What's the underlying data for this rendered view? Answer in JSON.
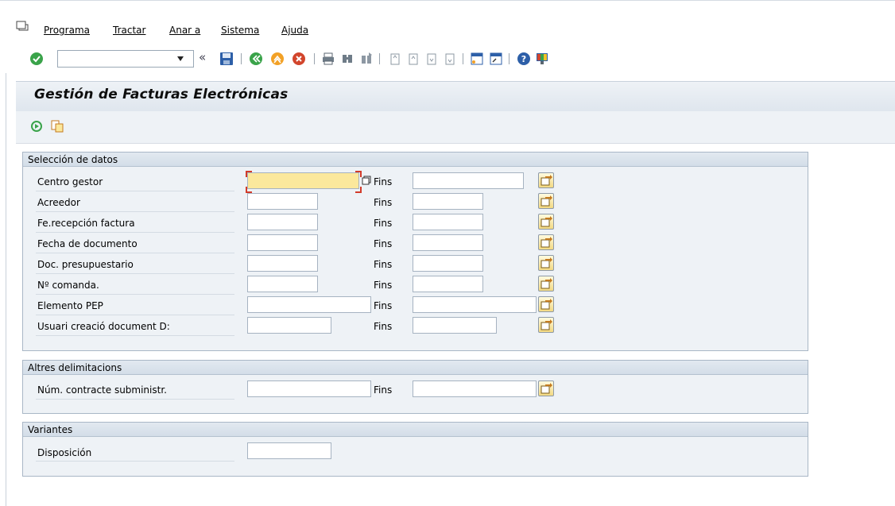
{
  "menu": {
    "items": [
      "Programa",
      "Tractar",
      "Anar a",
      "Sistema",
      "Ajuda"
    ]
  },
  "toolbar": {
    "command_value": "",
    "icons": [
      "check-icon",
      "dropdown-icon",
      "back-chevrons-icon",
      "save-icon",
      "back-icon",
      "exit-icon",
      "cancel-icon",
      "print-icon",
      "find-icon",
      "find-next-icon",
      "first-page-icon",
      "previous-page-icon",
      "next-page-icon",
      "last-page-icon",
      "new-session-icon",
      "shortcut-icon",
      "help-icon",
      "customize-layout-icon"
    ]
  },
  "title": "Gestión de Facturas Electrónicas",
  "app_toolbar": {
    "icons": [
      "execute-icon",
      "get-variant-icon"
    ]
  },
  "groups": {
    "seleccion": {
      "title": "Selección de datos",
      "to_label": "Fins",
      "rows": [
        {
          "label": "Centro gestor",
          "from": "",
          "to": ""
        },
        {
          "label": "Acreedor",
          "from": "",
          "to": ""
        },
        {
          "label": "Fe.recepción factura",
          "from": "",
          "to": ""
        },
        {
          "label": "Fecha de documento",
          "from": "",
          "to": ""
        },
        {
          "label": "Doc. presupuestario",
          "from": "",
          "to": ""
        },
        {
          "label": "Nº comanda.",
          "from": "",
          "to": ""
        },
        {
          "label": "Elemento PEP",
          "from": "",
          "to": ""
        },
        {
          "label": "Usuari creació document D:",
          "from": "",
          "to": ""
        }
      ]
    },
    "altres": {
      "title": "Altres delimitacions",
      "to_label": "Fins",
      "rows": [
        {
          "label": "Núm. contracte subministr.",
          "from": "",
          "to": ""
        }
      ]
    },
    "variantes": {
      "title": "Variantes",
      "rows": [
        {
          "label": "Disposición",
          "value": ""
        }
      ]
    }
  },
  "colors": {
    "active_field": "#fbe89c",
    "group_bg": "#eef2f6",
    "green_ok": "#3aa34a",
    "cancel_red": "#d2452c",
    "save_blue": "#2d5fa8"
  }
}
